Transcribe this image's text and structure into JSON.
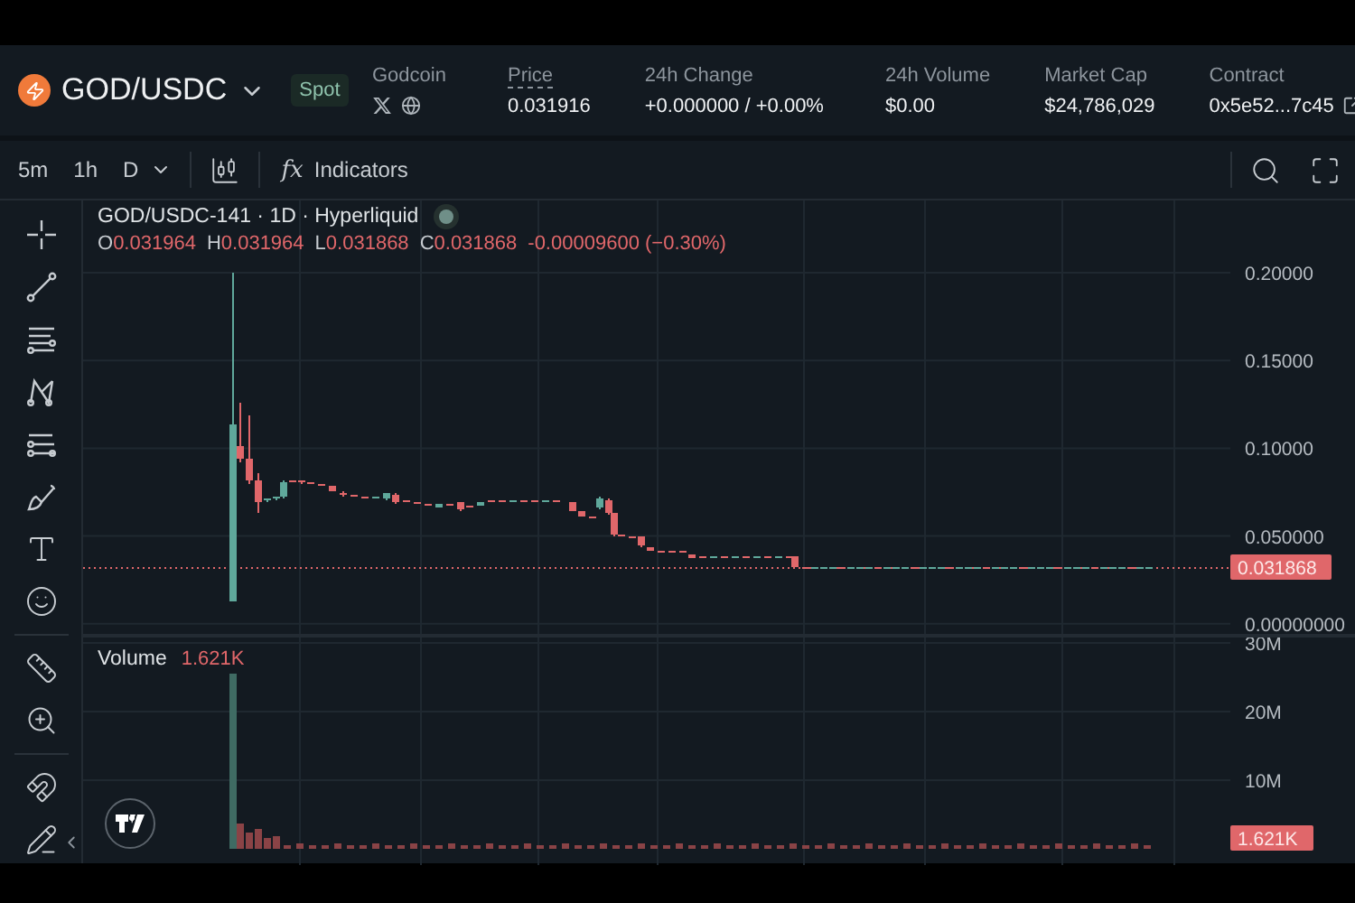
{
  "header": {
    "pair": "GOD/USDC",
    "market_type": "Spot",
    "stats": [
      {
        "kind": "links",
        "label": "Godcoin"
      },
      {
        "kind": "value",
        "label": "Price",
        "value": "0.031916",
        "underlined": true
      },
      {
        "kind": "value",
        "label": "24h Change",
        "value": "+0.000000 / +0.00%",
        "underlined": false
      },
      {
        "kind": "value",
        "label": "24h Volume",
        "value": "$0.00",
        "underlined": false
      },
      {
        "kind": "value",
        "label": "Market Cap",
        "value": "$24,786,029",
        "underlined": false
      },
      {
        "kind": "link",
        "label": "Contract",
        "value": "0x5e52...7c45",
        "underlined": false
      }
    ]
  },
  "toolbar": {
    "intervals": [
      "5m",
      "1h",
      "D"
    ],
    "indicators": {
      "icon": "fx",
      "label": "Indicators"
    }
  },
  "chart": {
    "title": "GOD/USDC-141 · 1D · Hyperliquid",
    "ohlc": [
      {
        "label": "O",
        "value": "0.031964"
      },
      {
        "label": "H",
        "value": "0.031964"
      },
      {
        "label": "L",
        "value": "0.031868"
      },
      {
        "label": "C",
        "value": "0.031868"
      }
    ],
    "change": "-0.00009600 (−0.30%)",
    "price_scale": [
      "0.20000",
      "0.15000",
      "0.10000",
      "0.050000",
      "0.00000000"
    ],
    "last_price": "0.031868"
  },
  "volume": {
    "label": "Volume",
    "value": "1.621K",
    "scale": [
      "30M",
      "20M",
      "10M"
    ],
    "last_volume": "1.621K"
  }
}
